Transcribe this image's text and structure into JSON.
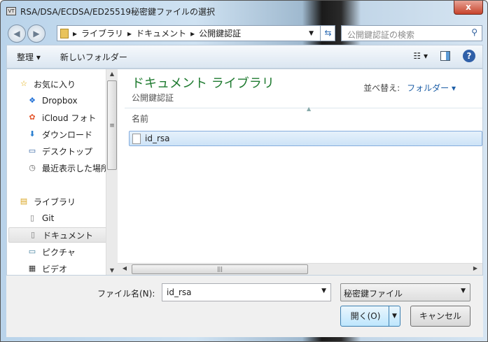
{
  "window": {
    "title": "RSA/DSA/ECDSA/ED25519秘密鍵ファイルの選択",
    "app_icon": "VT",
    "close_label": "x"
  },
  "address": {
    "crumbs": [
      "ライブラリ",
      "ドキュメント",
      "公開鍵認証"
    ],
    "search_placeholder": "公開鍵認証の検索"
  },
  "toolbar": {
    "organize": "整理 ▾",
    "new_folder": "新しいフォルダー",
    "view": "☷ ▾",
    "help": "?"
  },
  "sidebar": {
    "items": [
      {
        "label": "お気に入り",
        "icon": "☆"
      },
      {
        "label": "Dropbox",
        "icon": "❖"
      },
      {
        "label": "iCloud フォト",
        "icon": "✿"
      },
      {
        "label": "ダウンロード",
        "icon": "⬇"
      },
      {
        "label": "デスクトップ",
        "icon": "▭"
      },
      {
        "label": "最近表示した場所",
        "icon": "◷"
      },
      {
        "label": "ライブラリ",
        "icon": "▤"
      },
      {
        "label": "Git",
        "icon": "▯"
      },
      {
        "label": "ドキュメント",
        "icon": "▯"
      },
      {
        "label": "ピクチャ",
        "icon": "▭"
      },
      {
        "label": "ビデオ",
        "icon": "▦"
      }
    ],
    "selected": "ドキュメント"
  },
  "main": {
    "library_title": "ドキュメント ライブラリ",
    "library_subtitle": "公開鍵認証",
    "sort_label": "並べ替え:",
    "sort_value": "フォルダー ▾",
    "column_name": "名前",
    "files": [
      "id_rsa"
    ]
  },
  "footer": {
    "filename_label": "ファイル名(N):",
    "filename_value": "id_rsa",
    "filetype": "秘密鍵ファイル",
    "open": "開く(O)",
    "cancel": "キャンセル"
  }
}
